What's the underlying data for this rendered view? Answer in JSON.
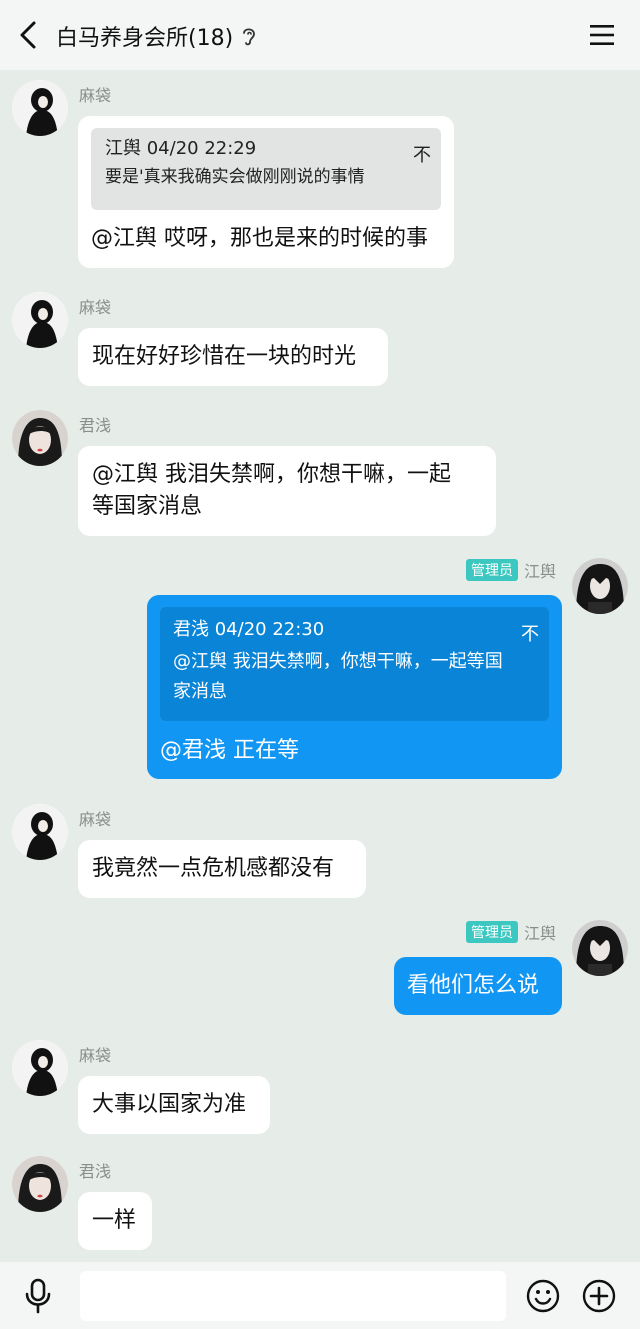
{
  "header": {
    "title": "白马养身会所(18)",
    "back_icon": "chevron-left-icon",
    "ear_icon": "ear-icon",
    "menu_icon": "hamburger-menu-icon"
  },
  "messages": [
    {
      "sender": "麻袋",
      "quote": {
        "author_time": "江舆 04/20 22:29",
        "jump": "不",
        "text": "要是'真来我确实会做刚刚说的事情"
      },
      "text": "@江舆 哎呀，那也是来的时候的事"
    },
    {
      "sender": "麻袋",
      "text": "现在好好珍惜在一块的时光"
    },
    {
      "sender": "君浅",
      "text_lines": [
        "@江舆 我泪失禁啊，你想干嘛，一起",
        "等国家消息"
      ]
    },
    {
      "sender": "江舆",
      "badge": "管理员",
      "quote": {
        "author_time": "君浅 04/20 22:30",
        "jump": "不",
        "text_lines": [
          "@江舆 我泪失禁啊，你想干嘛，一起等国",
          "家消息"
        ]
      },
      "text": "@君浅 正在等"
    },
    {
      "sender": "麻袋",
      "text": "我竟然一点危机感都没有"
    },
    {
      "sender": "江舆",
      "badge": "管理员",
      "text": "看他们怎么说"
    },
    {
      "sender": "麻袋",
      "text": "大事以国家为准"
    },
    {
      "sender": "君浅",
      "text": "一样"
    }
  ],
  "input": {
    "placeholder": "",
    "value": ""
  },
  "colors": {
    "background": "#e6ece7",
    "self_bubble": "#1296f3",
    "other_bubble": "#ffffff",
    "admin_badge": "#3cc7c0"
  },
  "icons": {
    "mic": "microphone-icon",
    "emoji": "smiley-icon",
    "plus": "plus-circle-icon"
  }
}
